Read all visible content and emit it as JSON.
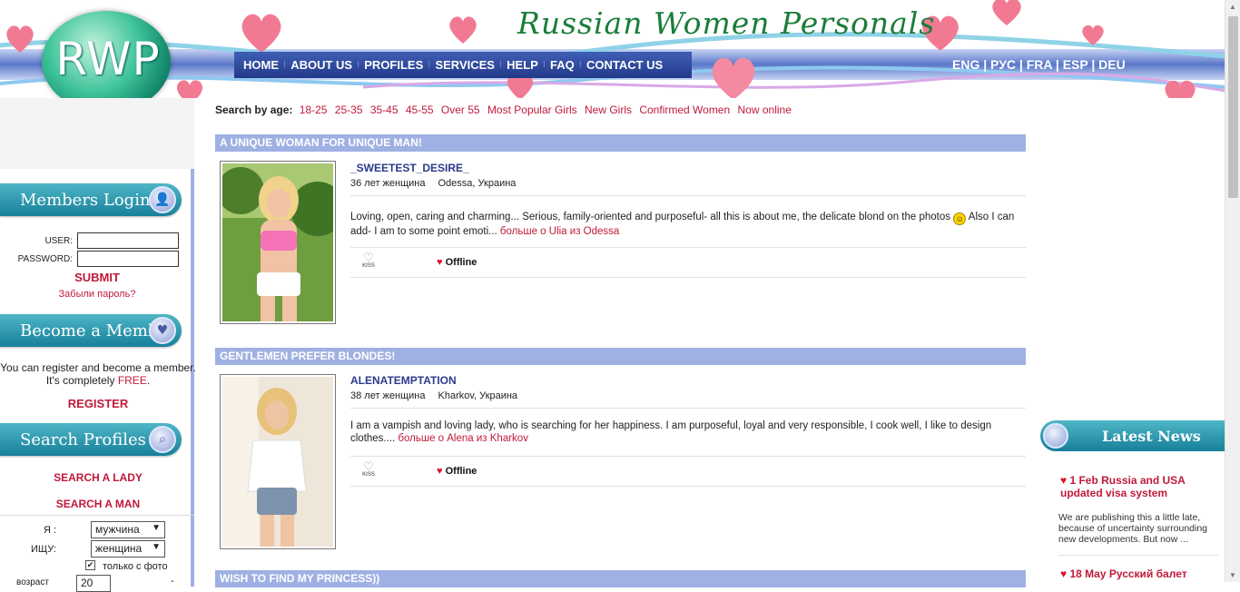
{
  "brand": {
    "logo_letters": "RWP",
    "site_title": "Russian Women Personals"
  },
  "nav": {
    "items": [
      "HOME",
      "ABOUT US",
      "PROFILES",
      "SERVICES",
      "HELP",
      "FAQ",
      "CONTACT US"
    ]
  },
  "languages": [
    "ENG",
    "РУС",
    "FRA",
    "ESP",
    "DEU"
  ],
  "search_bar": {
    "label": "Search by age:",
    "links": [
      "18-25",
      "25-35",
      "35-45",
      "45-55",
      "Over 55",
      "Most Popular Girls",
      "New Girls",
      "Confirmed Women",
      "Now online"
    ]
  },
  "sidebar": {
    "login_title": "Members  Login",
    "user_label": "USER:",
    "password_label": "PASSWORD:",
    "submit": "SUBMIT",
    "forgot": "Забыли пароль?",
    "member_title": "Become a Member",
    "register_text_1": "You can register and become a member.",
    "register_text_2a": "It's completely",
    "register_text_2b": "FREE",
    "register_text_2c": ".",
    "register_link": "REGISTER",
    "search_title": "Search  Profiles",
    "search_lady": "SEARCH A LADY",
    "search_man": "SEARCH A MAN",
    "i_label": "Я :",
    "i_value": "мужчина",
    "seek_label": "ИЩУ:",
    "seek_value": "женщина",
    "photo_only": "только с фото",
    "age_label": "возраст",
    "age_value": "20",
    "age_to": "-"
  },
  "profiles": [
    {
      "section": "A UNIQUE WOMAN FOR UNIQUE MAN!",
      "name": "_SWEETEST_DESIRE_",
      "age": "36 лет женщина",
      "city": "Odessa, Украина",
      "desc": "Loving, open, caring and charming... Serious, family-oriented and purposeful- all this is about me, the delicate blond on the photos",
      "desc_tail": "Also I can add- I am to some point emoti...",
      "more": "больше о Ulia из Odessa",
      "kiss": "KISS",
      "status": "Offline"
    },
    {
      "section": "GENTLEMEN PREFER BLONDES!",
      "name": "ALENATEMPTATION",
      "age": "38 лет женщина",
      "city": "Kharkov, Украина",
      "desc": "I am a vampish and loving lady, who is searching for her happiness. I am purposeful, loyal and very responsible, I cook well, I like to design clothes....",
      "desc_tail": "",
      "more": "больше о Alena из Kharkov",
      "kiss": "KISS",
      "status": "Offline"
    }
  ],
  "next_section": "WISH TO FIND MY PRINCESS))",
  "news": {
    "title": "Latest News",
    "items": [
      {
        "title": "1 Feb Russia and USA updated visa system",
        "body": "We are publishing this a little late, because of uncertainty surrounding new developments. But now ..."
      },
      {
        "title": "18 May Русский балет",
        "body": ""
      }
    ]
  },
  "colors": {
    "nav_blue": "#2a4396",
    "section_bar": "#9fb0e3",
    "link_red": "#c01a3a",
    "teal_panel": "#17809a",
    "title_green": "#1b7d3a"
  }
}
